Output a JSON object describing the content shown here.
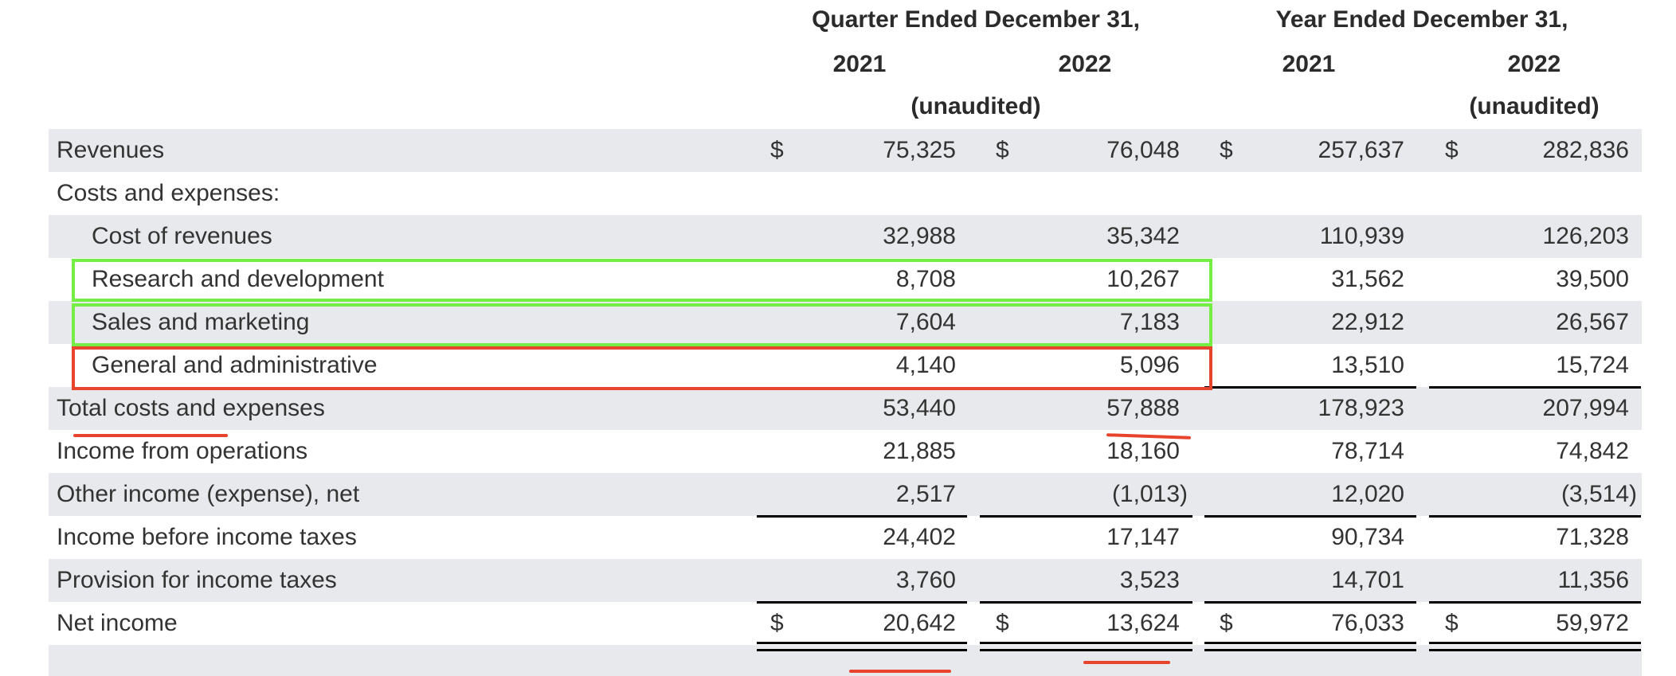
{
  "header": {
    "quarter_title": "Quarter Ended December 31,",
    "year_title": "Year Ended December 31,",
    "columns": [
      "2021",
      "2022",
      "2021",
      "2022"
    ],
    "quarter_note": "(unaudited)",
    "year_note": "(unaudited)"
  },
  "currency_symbol": "$",
  "rows": [
    {
      "label": "Revenues",
      "values": [
        "75,325",
        "76,048",
        "257,637",
        "282,836"
      ],
      "dollar": true,
      "indent": false
    },
    {
      "label": "Costs and expenses:",
      "values": [
        "",
        "",
        "",
        ""
      ],
      "dollar": false,
      "indent": false
    },
    {
      "label": "Cost of revenues",
      "values": [
        "32,988",
        "35,342",
        "110,939",
        "126,203"
      ],
      "dollar": false,
      "indent": true
    },
    {
      "label": "Research and development",
      "values": [
        "8,708",
        "10,267",
        "31,562",
        "39,500"
      ],
      "dollar": false,
      "indent": true
    },
    {
      "label": "Sales and marketing",
      "values": [
        "7,604",
        "7,183",
        "22,912",
        "26,567"
      ],
      "dollar": false,
      "indent": true
    },
    {
      "label": "General and administrative",
      "values": [
        "4,140",
        "5,096",
        "13,510",
        "15,724"
      ],
      "dollar": false,
      "indent": true
    },
    {
      "label": "Total costs and expenses",
      "values": [
        "53,440",
        "57,888",
        "178,923",
        "207,994"
      ],
      "dollar": false,
      "indent": false
    },
    {
      "label": "Income from operations",
      "values": [
        "21,885",
        "18,160",
        "78,714",
        "74,842"
      ],
      "dollar": false,
      "indent": false
    },
    {
      "label": "Other income (expense), net",
      "values": [
        "2,517",
        "(1,013)",
        "12,020",
        "(3,514)"
      ],
      "dollar": false,
      "indent": false
    },
    {
      "label": "Income before income taxes",
      "values": [
        "24,402",
        "17,147",
        "90,734",
        "71,328"
      ],
      "dollar": false,
      "indent": false
    },
    {
      "label": "Provision for income taxes",
      "values": [
        "3,760",
        "3,523",
        "14,701",
        "11,356"
      ],
      "dollar": false,
      "indent": false
    },
    {
      "label": "Net income",
      "values": [
        "20,642",
        "13,624",
        "76,033",
        "59,972"
      ],
      "dollar": true,
      "indent": false
    }
  ],
  "annotation_colors": {
    "green": "#74ee45",
    "red": "#e8432c"
  }
}
